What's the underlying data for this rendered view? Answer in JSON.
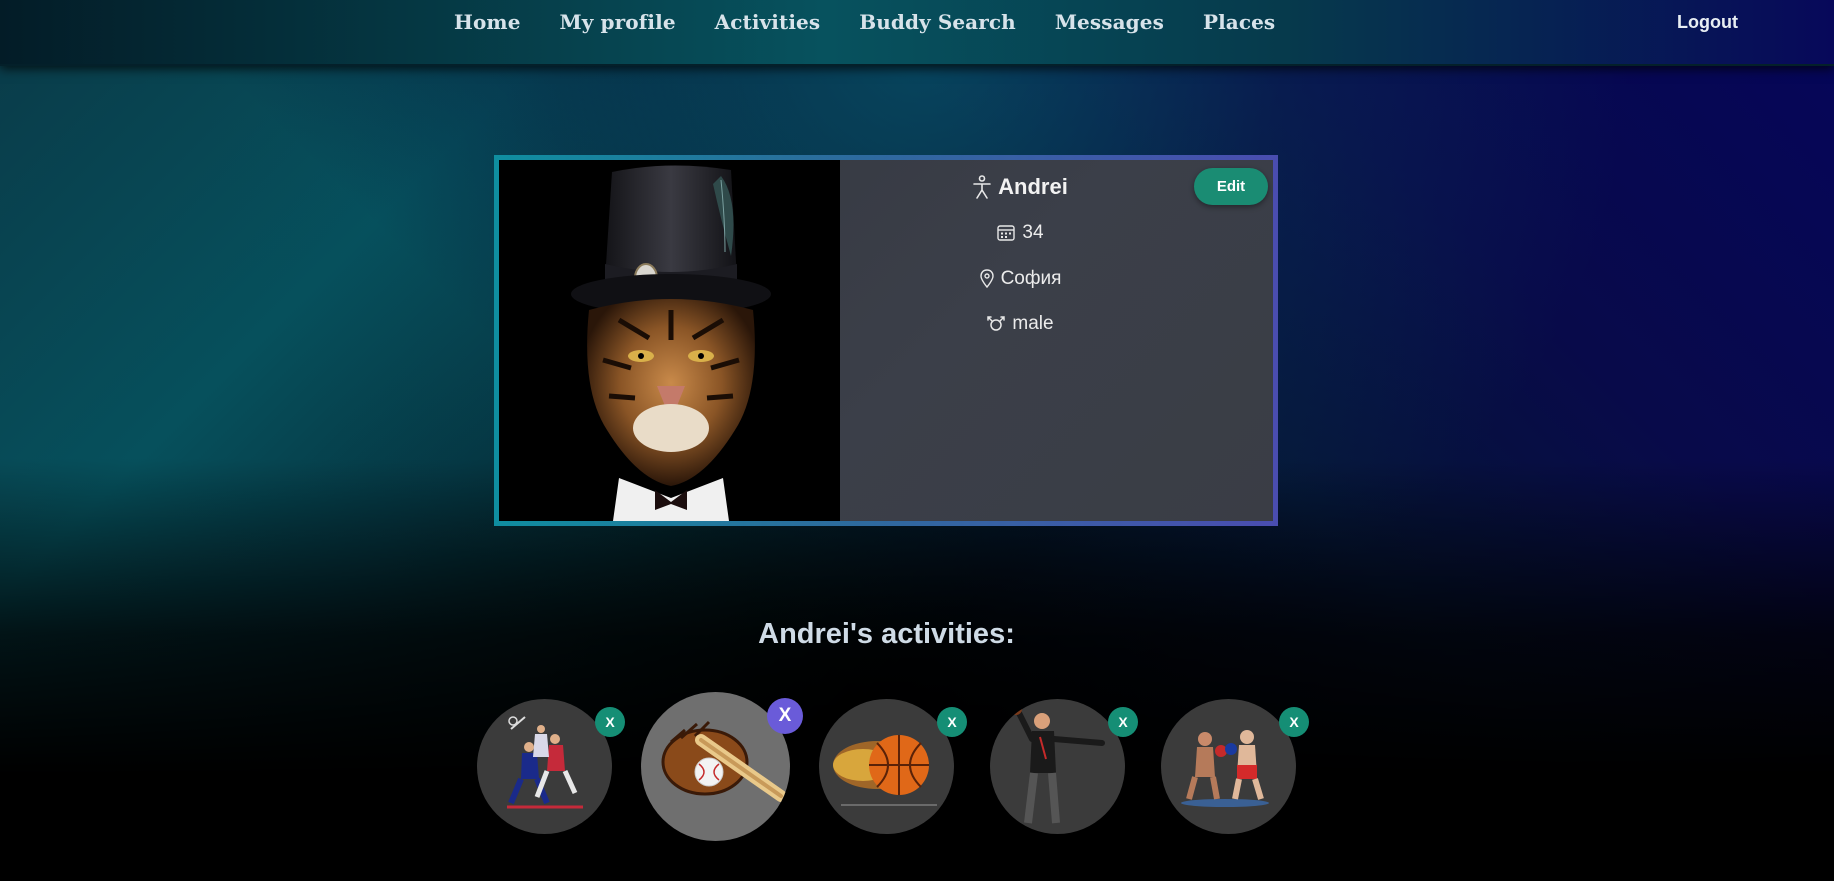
{
  "nav": {
    "links": [
      "Home",
      "My profile",
      "Activities",
      "Buddy Search",
      "Messages",
      "Places"
    ],
    "logout": "Logout"
  },
  "profile": {
    "name": "Andrei",
    "age": "34",
    "city": "София",
    "gender": "male",
    "edit_label": "Edit",
    "avatar": "tiger-in-top-hat-photo",
    "icons": {
      "name": "person-icon",
      "age": "calendar-icon",
      "city": "location-pin-icon",
      "gender": "gender-icon"
    }
  },
  "activities": {
    "title": "Andrei's activities:",
    "remove_label": "X",
    "items": [
      {
        "name": "badminton",
        "image": "badminton-players-photo"
      },
      {
        "name": "baseball",
        "image": "baseball-glove-bat-photo",
        "hovered": true
      },
      {
        "name": "basketball",
        "image": "flaming-basketball-photo"
      },
      {
        "name": "bowling",
        "image": "bowler-photo"
      },
      {
        "name": "boxing",
        "image": "boxers-photo"
      }
    ]
  },
  "colors": {
    "accent_green": "#1a8c73",
    "hover_purple": "#6a5bd9",
    "card_border_start": "#0f8ea0",
    "card_border_end": "#4a4db0"
  }
}
